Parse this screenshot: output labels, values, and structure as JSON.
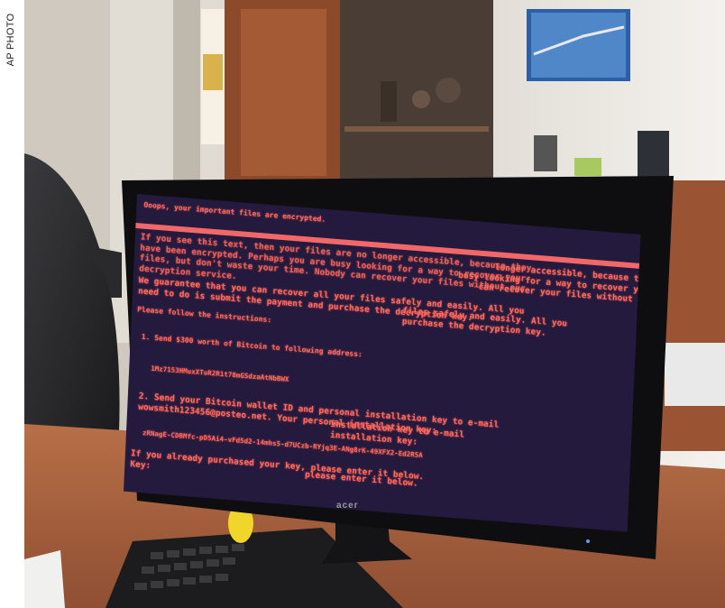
{
  "credit": "AP PHOTO",
  "screen": {
    "title": "Ooops, your important files are encrypted.",
    "paragraph1_small": [
      "If you see this text, then your files are no longer accessible, because they",
      "have been encrypted.  Perhaps you are busy looking for a way to recover your",
      "files, but don't waste your time.  Nobody can recover your files without our",
      "decryption service."
    ],
    "paragraph1_large": [
      "longer accessible, because they",
      "busy looking for a way to recover your",
      "can recover your files without our"
    ],
    "paragraph2_small": [
      "We guarantee that you can recover all your files safely and easily.  All you",
      "need to do is submit the payment and purchase the decryption key."
    ],
    "paragraph2_large": [
      "files safely and easily.  All you",
      "purchase the decryption key."
    ],
    "instructions": "Please follow the instructions:",
    "step1": "1. Send $300 worth of Bitcoin to following address:",
    "bitcoin_address": "1Mz7153HMuxXTuR2R1t78mGSdzaAtNbBWX",
    "step2_small": [
      "2. Send your Bitcoin wallet ID and personal installation key to e-mail",
      "   wowsmith123456@posteo.net. Your personal installation key:"
    ],
    "step2_large": [
      "installation key to e-mail",
      "installation key:"
    ],
    "install_key": "zRNagE-CDBMfc-pD5Ai4-vFd5d2-14mhs5-d7UCzb-RYjq3E-ANg8rK-49XFX2-Ed2R5A",
    "footer_small": [
      "If you already purchased your key, please enter it below.",
      "Key:"
    ],
    "footer_large": [
      "please enter it below."
    ],
    "monitor_brand": "acer"
  },
  "colors": {
    "screen_bg": "#231a3e",
    "screen_text": "#ff6b5e",
    "screen_bar": "#f26868"
  }
}
